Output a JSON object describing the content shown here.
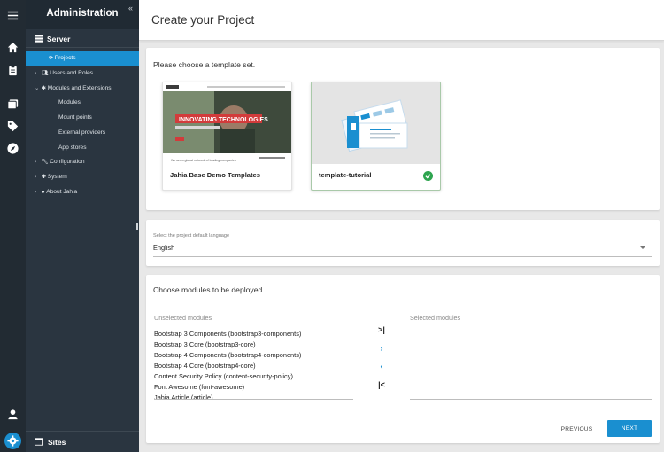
{
  "sidebar": {
    "title": "Administration",
    "collapse_glyph": "«",
    "section": "Server",
    "items": [
      {
        "label": "Projects",
        "icon": "projects-icon",
        "chevron": "",
        "active": true
      },
      {
        "label": "Users and Roles",
        "icon": "users-icon",
        "chevron": "›"
      },
      {
        "label": "Modules and Extensions",
        "icon": "puzzle-icon",
        "chevron": "⌄"
      },
      {
        "label": "Modules",
        "indent": true
      },
      {
        "label": "Mount points",
        "indent": true
      },
      {
        "label": "External providers",
        "indent": true
      },
      {
        "label": "App stores",
        "indent": true
      },
      {
        "label": "Configuration",
        "icon": "wrench-icon",
        "chevron": "›"
      },
      {
        "label": "System",
        "icon": "system-icon",
        "chevron": "›"
      },
      {
        "label": "About Jahia",
        "icon": "info-icon",
        "chevron": "›"
      }
    ],
    "bottom": "Sites"
  },
  "header": {
    "title": "Create your Project"
  },
  "templates": {
    "heading": "Please choose a template set.",
    "items": [
      {
        "name": "Jahia Base Demo Templates",
        "selected": false,
        "preview_banner": "INNOVATING TECHNOLOGIES",
        "preview_tagline": "We are a global network of leading companies"
      },
      {
        "name": "template-tutorial",
        "selected": true
      }
    ]
  },
  "language": {
    "label": "Select the project default language",
    "value": "English"
  },
  "modules": {
    "heading": "Choose modules to be deployed",
    "unselected_label": "Unselected modules",
    "selected_label": "Selected modules",
    "unselected": [
      "Bootstrap 3 Components (bootstrap3-components)",
      "Bootstrap 3 Core (bootstrap3-core)",
      "Bootstrap 4 Components (bootstrap4-components)",
      "Bootstrap 4 Core (bootstrap4-core)",
      "Content Security Policy (content-security-policy)",
      "Font Awesome (font-awesome)",
      "Jahia Article (article)"
    ],
    "selected": [],
    "transfer": {
      "move_all_right": ">|",
      "move_right": "›",
      "move_left": "‹",
      "move_all_left": "|<"
    }
  },
  "actions": {
    "previous": "PREVIOUS",
    "next": "NEXT"
  },
  "colors": {
    "accent": "#1a8fd0",
    "sidebar": "#2a3540",
    "rail": "#222b33",
    "success": "#2ea44f"
  }
}
